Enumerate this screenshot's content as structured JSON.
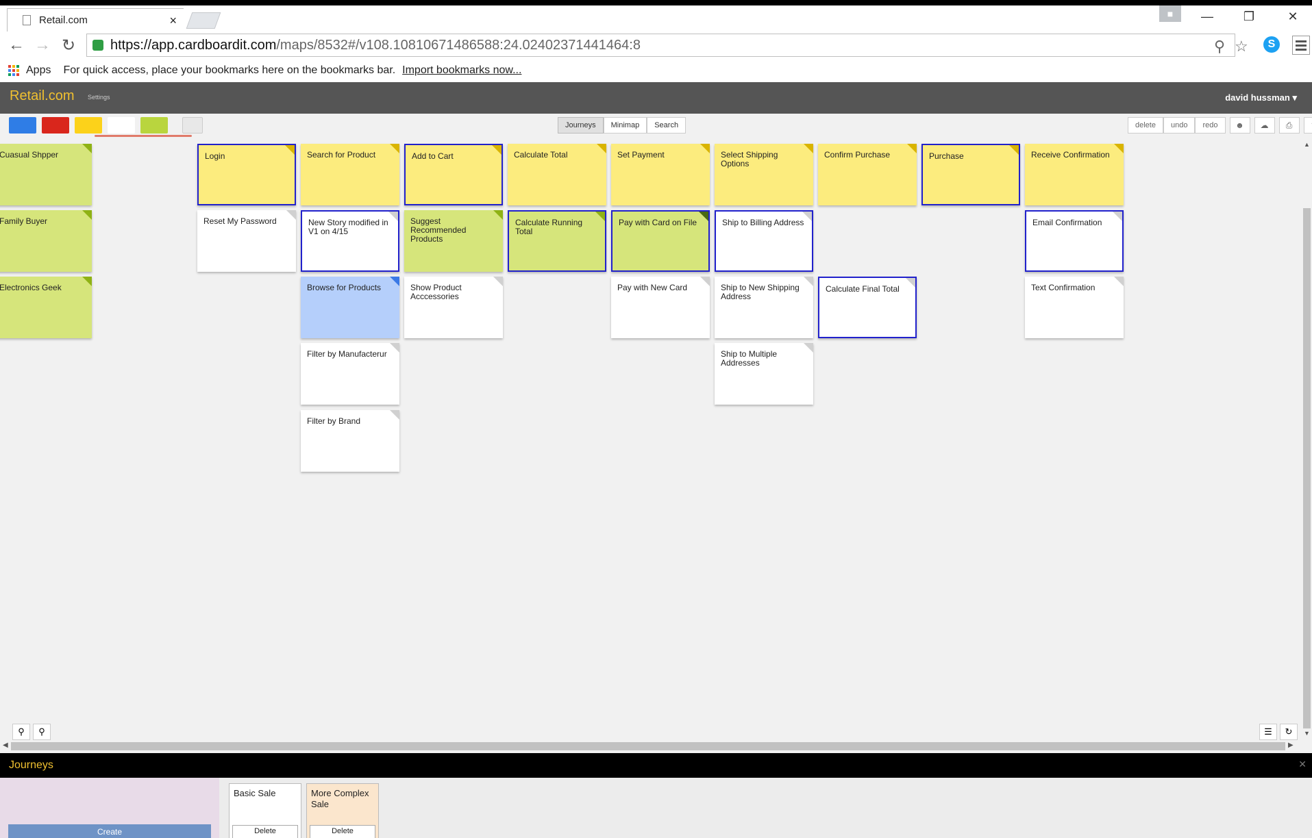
{
  "browser": {
    "tab_title": "Retail.com",
    "tab_close": "×",
    "url_host": "https://app.cardboardit.com",
    "url_path": "/maps/8532#/v108.10810671486588:24.02402371441464:8",
    "bookmarks_apps": "Apps",
    "bookmarks_hint": "For quick access, place your bookmarks here on the bookmarks bar.",
    "bookmarks_import": "Import bookmarks now..."
  },
  "app": {
    "title": "Retail.com",
    "settings_label": "Settings",
    "user": "david hussman",
    "colors": [
      "#2f7de6",
      "#d9261c",
      "#fcd21a",
      "#ffffff",
      "#b9d53e"
    ]
  },
  "toolbar": {
    "views": [
      "Journeys",
      "Minimap",
      "Search"
    ],
    "actions": [
      "delete",
      "undo",
      "redo"
    ]
  },
  "cards": {
    "personas": [
      "Cuasual Shpper",
      "Family Buyer",
      "Electronics Geek"
    ],
    "activities": [
      "Login",
      "Search for Product",
      "Add to Cart",
      "Calculate Total",
      "Set Payment",
      "Select Shipping Options",
      "Confirm Purchase",
      "Purchase",
      "Receive Confirmation"
    ],
    "stories": {
      "reset_password": "Reset My Password",
      "new_story": "New Story modified in V1 on 4/15",
      "suggest_products": "Suggest Recommended Products",
      "calc_running_total": "Calculate Running Total",
      "pay_card_on_file": "Pay with Card on File",
      "ship_billing": "Ship to Billing Address",
      "email_confirmation": "Email Confirmation",
      "browse_products": "Browse for Products",
      "show_accessories": "Show Product Acccessories",
      "pay_new_card": "Pay with New Card",
      "ship_new_address": "Ship to New Shipping Address",
      "calc_final_total": "Calculate Final Total",
      "text_confirmation": "Text Confirmation",
      "filter_manufacturer": "Filter by Manufacterur",
      "ship_multiple": "Ship to Multiple Addresses",
      "filter_brand": "Filter by Brand"
    }
  },
  "journeys": {
    "title": "Journeys",
    "create_label": "Create",
    "items": [
      {
        "name": "Basic Sale",
        "delete_label": "Delete"
      },
      {
        "name": "More Complex Sale",
        "delete_label": "Delete"
      }
    ]
  }
}
